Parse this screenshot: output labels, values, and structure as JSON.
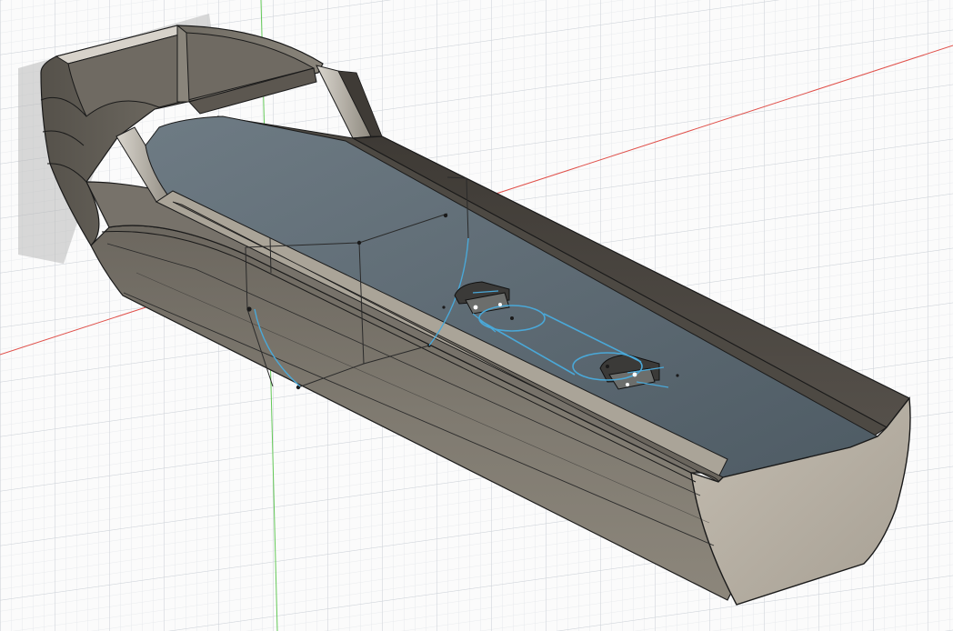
{
  "viewport": {
    "background": "#fbfbfb",
    "grid_minor_color": "#e3e6ea",
    "grid_major_color": "#cdd2d8",
    "x_axis_color": "#e0504a",
    "z_axis_color": "#63c857"
  },
  "model": {
    "body_color": "#7a756c",
    "body_dark": "#4b4741",
    "body_light": "#a9a398",
    "end_face_color": "#b8b1a6",
    "floor_color": "#5a6872",
    "edge_color": "#1a1a1a",
    "sketch_color": "#4aa8d8",
    "section_line_color": "#2a2a2a"
  }
}
